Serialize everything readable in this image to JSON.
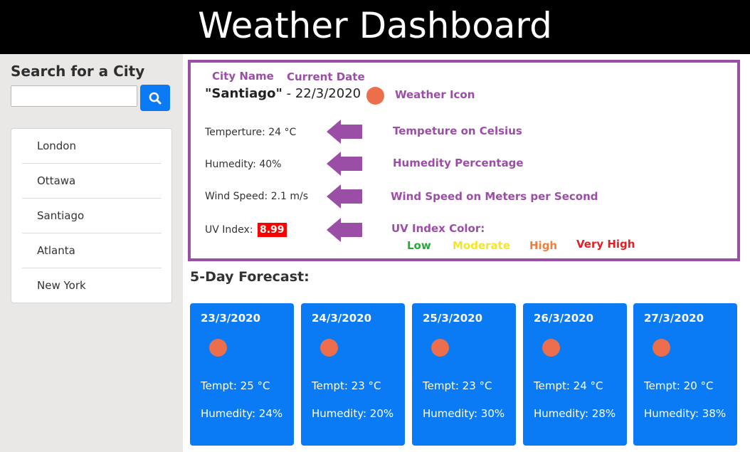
{
  "header": {
    "title": "Weather Dashboard"
  },
  "sidebar": {
    "search_heading": "Search for a City",
    "search_value": "",
    "search_icon": "search-icon",
    "history": [
      "London",
      "Ottawa",
      "Santiago",
      "Atlanta",
      "New York"
    ]
  },
  "current": {
    "city": "\"Santiago\"",
    "separator": " - ",
    "date": "22/3/2020",
    "temperature": "Temperture: 24 °C",
    "humidity": "Humedity: 40%",
    "wind": "Wind Speed: 2.1 m/s",
    "uv_label": "UV Index: ",
    "uv_value": "8.99",
    "uv_color": "#ff0000",
    "weather_icon_color": "#ec6e4c"
  },
  "annotations": {
    "city_name": "City Name",
    "current_date": "Current Date",
    "weather_icon": "Weather Icon",
    "temp": "Tempeture on Celsius",
    "humidity": "Humedity Percentage",
    "wind": "Wind Speed on Meters per Second",
    "uv": "UV Index Color:",
    "uv_levels": [
      {
        "label": "Low",
        "color": "#2aa837"
      },
      {
        "label": "Moderate",
        "color": "#f5e52a"
      },
      {
        "label": "High",
        "color": "#f07f3c"
      },
      {
        "label": "Very High",
        "color": "#e41e25"
      }
    ],
    "accent_color": "#9b4ea6"
  },
  "forecast": {
    "heading": "5-Day Forecast:",
    "days": [
      {
        "date": "23/3/2020",
        "temp": "Tempt: 25 °C",
        "humidity": "Humedity: 24%"
      },
      {
        "date": "24/3/2020",
        "temp": "Tempt: 23 °C",
        "humidity": "Humedity: 20%"
      },
      {
        "date": "25/3/2020",
        "temp": "Tempt: 23 °C",
        "humidity": "Humedity: 30%"
      },
      {
        "date": "26/3/2020",
        "temp": "Tempt: 24 °C",
        "humidity": "Humedity: 28%"
      },
      {
        "date": "27/3/2020",
        "temp": "Tempt: 20 °C",
        "humidity": "Humedity: 38%"
      }
    ]
  }
}
